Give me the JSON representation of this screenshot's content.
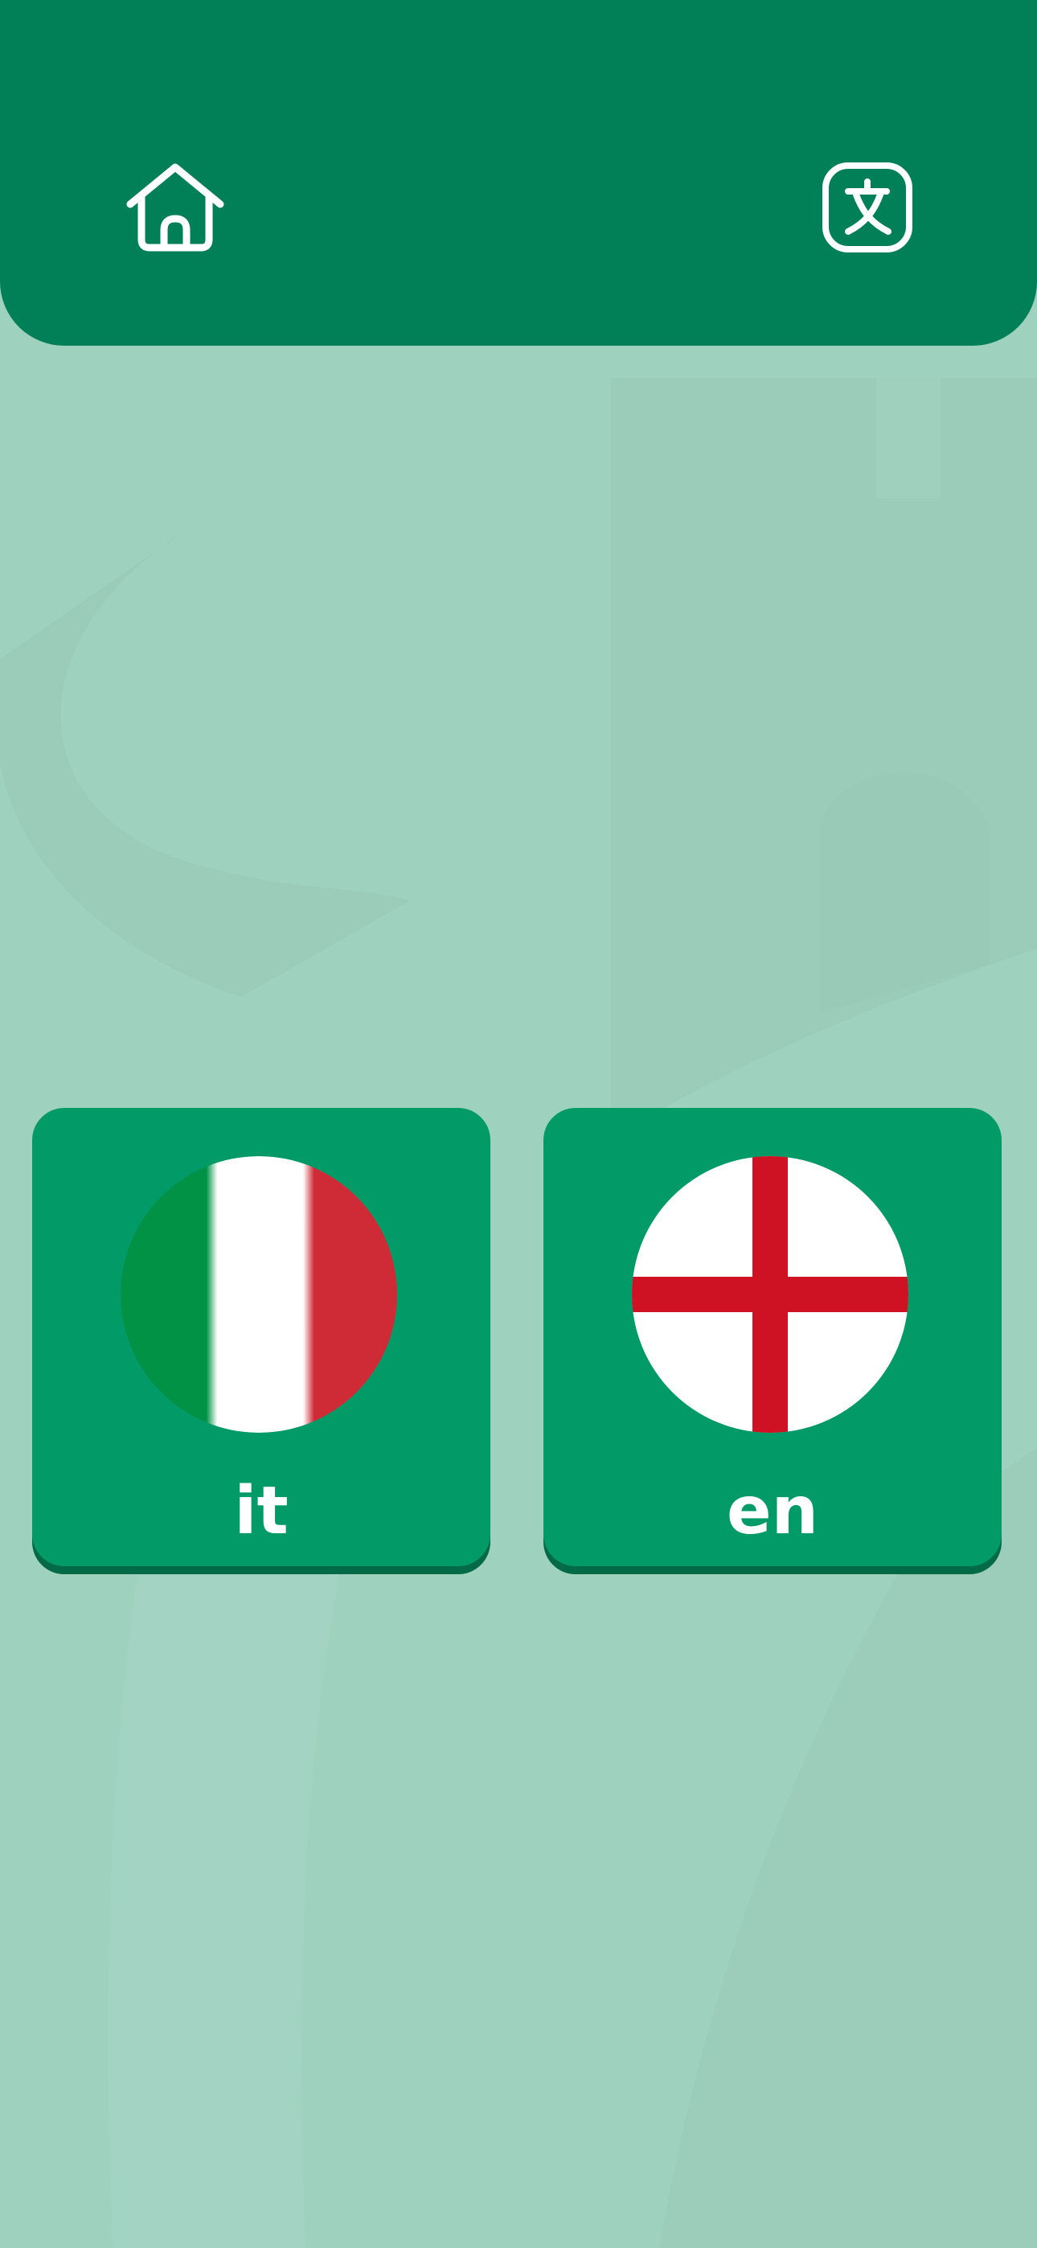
{
  "header": {
    "home_icon": "home-icon",
    "translate_icon": "translate-icon",
    "background_color": "#017f56"
  },
  "languages": [
    {
      "code": "it",
      "flag": "italy-flag"
    },
    {
      "code": "en",
      "flag": "england-flag"
    }
  ],
  "colors": {
    "page_background": "#9fd1bf",
    "card_background": "#029b68",
    "card_shadow": "#036a48",
    "italy_green": "#019246",
    "italy_white": "#ffffff",
    "italy_red": "#cf2b37",
    "england_white": "#ffffff",
    "england_red": "#cf1124"
  }
}
